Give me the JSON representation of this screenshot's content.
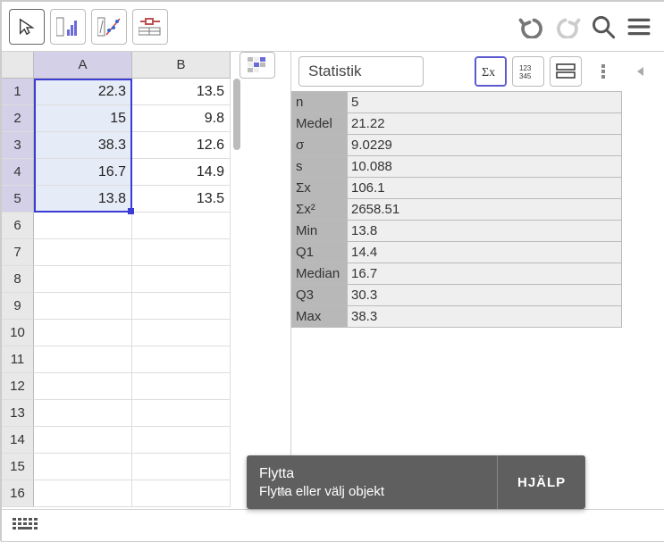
{
  "toolbar": {
    "undo": "undo",
    "redo": "redo",
    "search": "search",
    "menu": "menu"
  },
  "spreadsheet": {
    "columns": [
      "A",
      "B"
    ],
    "row_count": 16,
    "selection": {
      "col": "A",
      "rows": [
        1,
        2,
        3,
        4,
        5
      ]
    },
    "data": {
      "A": [
        "22.3",
        "15",
        "38.3",
        "16.7",
        "13.8",
        "",
        "",
        "",
        "",
        "",
        "",
        "",
        "",
        "",
        "",
        ""
      ],
      "B": [
        "13.5",
        "9.8",
        "12.6",
        "14.9",
        "13.5",
        "",
        "",
        "",
        "",
        "",
        "",
        "",
        "",
        "",
        "",
        ""
      ]
    }
  },
  "stats": {
    "title": "Statistik",
    "rows": [
      {
        "label": "n",
        "value": "5"
      },
      {
        "label": "Medel",
        "value": "21.22"
      },
      {
        "label": "σ",
        "value": "9.0229"
      },
      {
        "label": "s",
        "value": "10.088"
      },
      {
        "label": "Σx",
        "value": "106.1"
      },
      {
        "label": "Σx²",
        "value": "2658.51"
      },
      {
        "label": "Min",
        "value": "13.8"
      },
      {
        "label": "Q1",
        "value": "14.4"
      },
      {
        "label": "Median",
        "value": "16.7"
      },
      {
        "label": "Q3",
        "value": "30.3"
      },
      {
        "label": "Max",
        "value": "38.3"
      }
    ]
  },
  "tooltip": {
    "title": "Flytta",
    "desc": "Flytta eller välj objekt",
    "help": "HJÄLP"
  },
  "chart_data": {
    "type": "table",
    "title": "Statistik",
    "series": [
      {
        "name": "A",
        "values": [
          22.3,
          15,
          38.3,
          16.7,
          13.8
        ]
      },
      {
        "name": "B",
        "values": [
          13.5,
          9.8,
          12.6,
          14.9,
          13.5
        ]
      }
    ],
    "summary_for": "A",
    "summary": {
      "n": 5,
      "mean": 21.22,
      "sigma": 9.0229,
      "s": 10.088,
      "sum_x": 106.1,
      "sum_x2": 2658.51,
      "min": 13.8,
      "q1": 14.4,
      "median": 16.7,
      "q3": 30.3,
      "max": 38.3
    }
  }
}
